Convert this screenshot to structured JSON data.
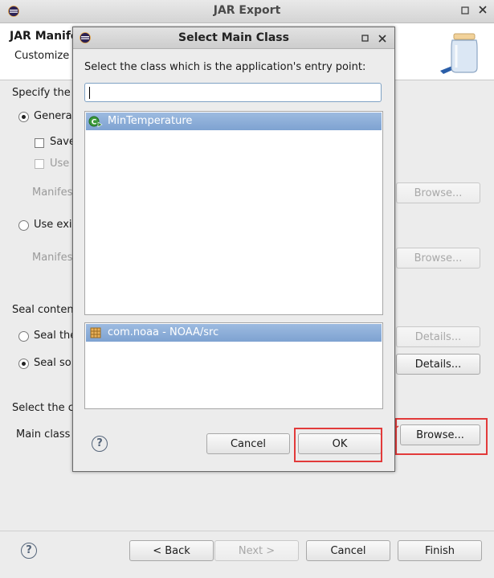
{
  "window": {
    "title": "JAR Export",
    "header_title": "JAR Manife",
    "header_subtitle": "Customize"
  },
  "wizard": {
    "specify_label": "Specify the",
    "generate_label": "Genera",
    "save_label": "Save",
    "use_label": "Use",
    "manifest_label_1": "Manifes",
    "use_existing_label": "Use exi",
    "manifest_label_2": "Manifes",
    "seal_contents_label": "Seal conten",
    "seal_the_label": "Seal the",
    "seal_some_label": "Seal so",
    "select_class_label": "Select the c",
    "main_class_label": "Main class",
    "browse_label": "Browse...",
    "details_label": "Details...",
    "browse_main_label": "Browse..."
  },
  "footer": {
    "back_label": "< Back",
    "next_label": "Next >",
    "cancel_label": "Cancel",
    "finish_label": "Finish"
  },
  "dialog": {
    "title": "Select Main Class",
    "prompt": "Select the class which is the application's entry point:",
    "filter_value": "",
    "classes": [
      "MinTemperature"
    ],
    "packages": [
      "com.noaa - NOAA/src"
    ],
    "cancel_label": "Cancel",
    "ok_label": "OK"
  },
  "colors": {
    "highlight": "#e23a3a",
    "selection": "#7ea2d1"
  }
}
